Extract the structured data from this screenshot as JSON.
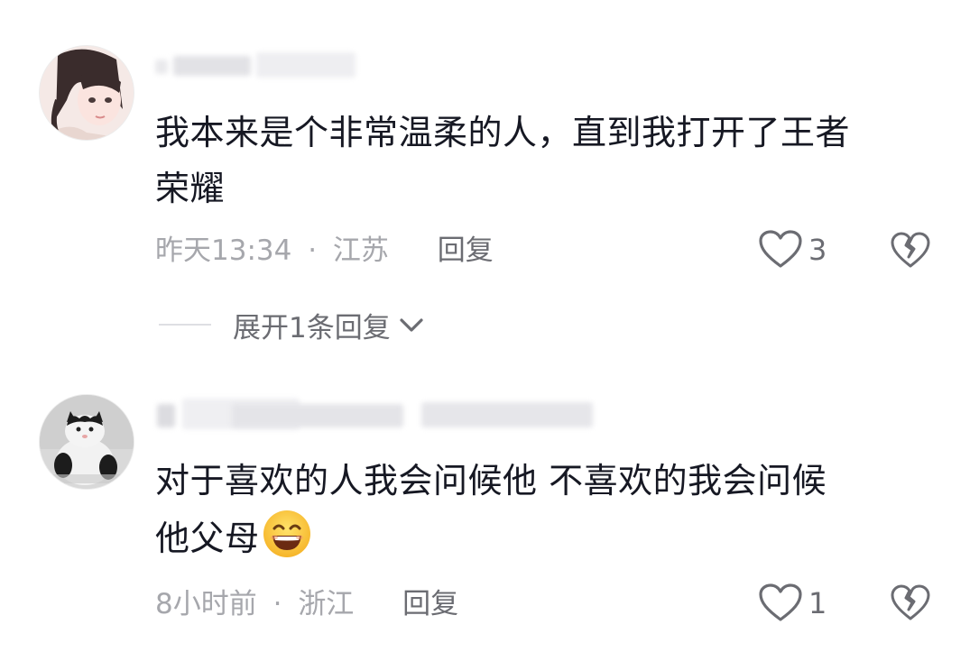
{
  "comments": [
    {
      "text_line1": "我本来是个非常温柔的人，直到我打开了王者",
      "text_line2": "荣耀",
      "time": "昨天13:34",
      "separator": "·",
      "location": "江苏",
      "reply_label": "回复",
      "like_count": "3",
      "expand_label": "展开1条回复"
    },
    {
      "text_line1": "对于喜欢的人我会问候他 不喜欢的我会问候",
      "text_line2": "他父母",
      "time": "8小时前",
      "separator": "·",
      "location": "浙江",
      "reply_label": "回复",
      "like_count": "1"
    }
  ],
  "icons": {
    "like": "heart-outline-icon",
    "dislike": "broken-heart-icon",
    "expand": "chevron-down-icon",
    "emoji": "grinning-face-emoji"
  },
  "colors": {
    "text_primary": "#161823",
    "text_secondary": "#a6a7ac",
    "text_action": "#6b6c72"
  }
}
